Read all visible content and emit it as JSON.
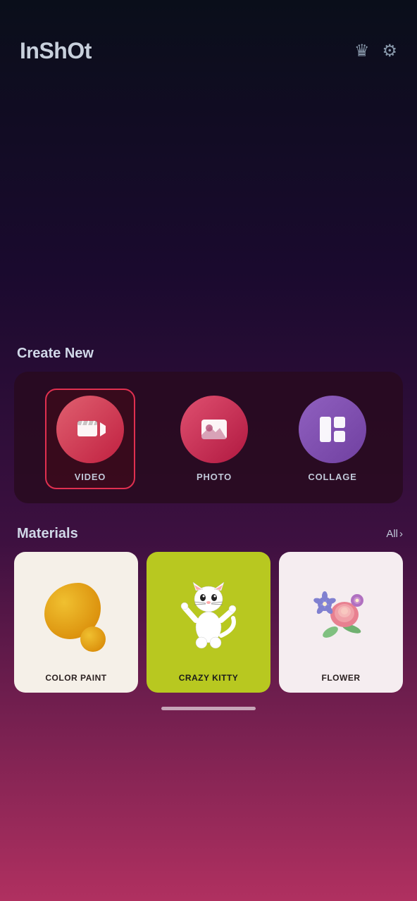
{
  "app": {
    "logo": "InShOt"
  },
  "header": {
    "crown_icon": "♛",
    "settings_icon": "⚙"
  },
  "create_new": {
    "title": "Create New",
    "items": [
      {
        "id": "video",
        "label": "VIDEO",
        "selected": true
      },
      {
        "id": "photo",
        "label": "PHOTO",
        "selected": false
      },
      {
        "id": "collage",
        "label": "COLLAGE",
        "selected": false
      }
    ]
  },
  "materials": {
    "title": "Materials",
    "all_label": "All",
    "items": [
      {
        "id": "color-paint",
        "label": "COLOR PAINT",
        "theme": "light"
      },
      {
        "id": "crazy-kitty",
        "label": "CRAZY KITTY",
        "theme": "yellow-green"
      },
      {
        "id": "flower",
        "label": "FLOWER",
        "theme": "light-pink"
      }
    ]
  },
  "home_indicator": ""
}
